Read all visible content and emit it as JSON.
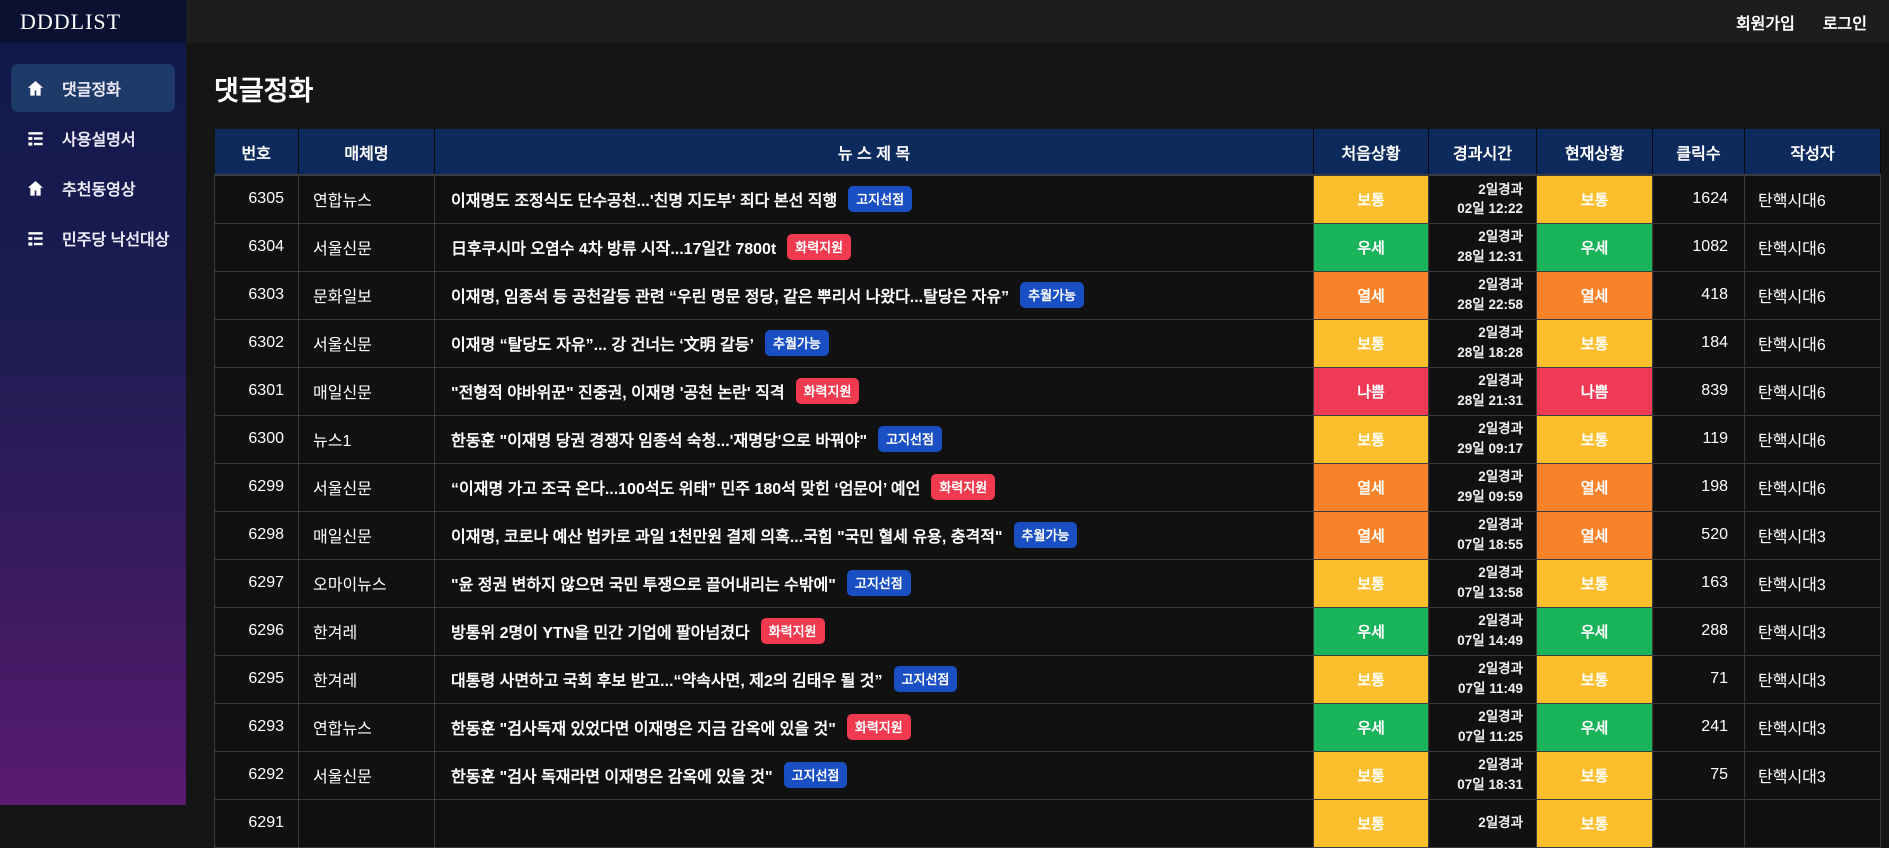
{
  "brand": "DDDLIST",
  "topbar": {
    "signup": "회원가입",
    "login": "로그인"
  },
  "page": {
    "title": "댓글정화"
  },
  "sidebar": {
    "items": [
      {
        "icon": "home",
        "label": "댓글정화",
        "active": true
      },
      {
        "icon": "list",
        "label": "사용설명서",
        "active": false
      },
      {
        "icon": "home",
        "label": "추천동영상",
        "active": false
      },
      {
        "icon": "list",
        "label": "민주당 낙선대상",
        "active": false
      }
    ]
  },
  "colors": {
    "status": {
      "보통": "#fcbe2d",
      "우세": "#1ab45b",
      "열세": "#f8822a",
      "나쁨": "#ee3a55"
    },
    "badge": {
      "고지선점": "#1a4fc4",
      "추월가능": "#1a4fc4",
      "화력지원": "#ef3a4f"
    },
    "header_bg": "#0c2a5c",
    "accent_purple": "#5a1a70"
  },
  "table": {
    "headers": [
      "번호",
      "매체명",
      "뉴 스 제 목",
      "처음상황",
      "경과시간",
      "현재상황",
      "클릭수",
      "작성자"
    ],
    "rows": [
      {
        "no": "6305",
        "media": "연합뉴스",
        "title": "이재명도 조정식도 단수공천...'친명 지도부' 죄다 본선 직행",
        "badge": "고지선점",
        "start": "보통",
        "elapsed1": "2일경과",
        "elapsed2": "02일 12:22",
        "now": "보통",
        "clicks": "1624",
        "author": "탄핵시대6"
      },
      {
        "no": "6304",
        "media": "서울신문",
        "title": "日후쿠시마 오염수 4차 방류 시작...17일간 7800t",
        "badge": "화력지원",
        "start": "우세",
        "elapsed1": "2일경과",
        "elapsed2": "28일 12:31",
        "now": "우세",
        "clicks": "1082",
        "author": "탄핵시대6"
      },
      {
        "no": "6303",
        "media": "문화일보",
        "title": "이재명, 임종석 등 공천갈등 관련 “우린 명문 정당, 같은 뿌리서 나왔다...탈당은 자유”",
        "badge": "추월가능",
        "start": "열세",
        "elapsed1": "2일경과",
        "elapsed2": "28일 22:58",
        "now": "열세",
        "clicks": "418",
        "author": "탄핵시대6"
      },
      {
        "no": "6302",
        "media": "서울신문",
        "title": "이재명 “탈당도 자유”... 강 건너는 ‘文明 갈등’",
        "badge": "추월가능",
        "start": "보통",
        "elapsed1": "2일경과",
        "elapsed2": "28일 18:28",
        "now": "보통",
        "clicks": "184",
        "author": "탄핵시대6"
      },
      {
        "no": "6301",
        "media": "매일신문",
        "title": "\"전형적 야바위꾼\" 진중권, 이재명 '공천 논란' 직격",
        "badge": "화력지원",
        "start": "나쁨",
        "elapsed1": "2일경과",
        "elapsed2": "28일 21:31",
        "now": "나쁨",
        "clicks": "839",
        "author": "탄핵시대6"
      },
      {
        "no": "6300",
        "media": "뉴스1",
        "title": "한동훈 \"이재명 당권 경쟁자 임종석 숙청...'재명당'으로 바꿔야\"",
        "badge": "고지선점",
        "start": "보통",
        "elapsed1": "2일경과",
        "elapsed2": "29일 09:17",
        "now": "보통",
        "clicks": "119",
        "author": "탄핵시대6"
      },
      {
        "no": "6299",
        "media": "서울신문",
        "title": "“이재명 가고 조국 온다...100석도 위태” 민주 180석 맞힌 ‘엄문어’ 예언",
        "badge": "화력지원",
        "start": "열세",
        "elapsed1": "2일경과",
        "elapsed2": "29일 09:59",
        "now": "열세",
        "clicks": "198",
        "author": "탄핵시대6"
      },
      {
        "no": "6298",
        "media": "매일신문",
        "title": "이재명, 코로나 예산 법카로 과일 1천만원 결제 의혹...국힘 \"국민 혈세 유용, 충격적\"",
        "badge": "추월가능",
        "start": "열세",
        "elapsed1": "2일경과",
        "elapsed2": "07일 18:55",
        "now": "열세",
        "clicks": "520",
        "author": "탄핵시대3"
      },
      {
        "no": "6297",
        "media": "오마이뉴스",
        "title": "\"윤 정권 변하지 않으면 국민 투쟁으로 끌어내리는 수밖에\"",
        "badge": "고지선점",
        "start": "보통",
        "elapsed1": "2일경과",
        "elapsed2": "07일 13:58",
        "now": "보통",
        "clicks": "163",
        "author": "탄핵시대3"
      },
      {
        "no": "6296",
        "media": "한겨레",
        "title": "방통위 2명이 YTN을 민간 기업에 팔아넘겼다",
        "badge": "화력지원",
        "start": "우세",
        "elapsed1": "2일경과",
        "elapsed2": "07일 14:49",
        "now": "우세",
        "clicks": "288",
        "author": "탄핵시대3"
      },
      {
        "no": "6295",
        "media": "한겨레",
        "title": "대통령 사면하고 국회 후보 받고...“약속사면, 제2의 김태우 될 것”",
        "badge": "고지선점",
        "start": "보통",
        "elapsed1": "2일경과",
        "elapsed2": "07일 11:49",
        "now": "보통",
        "clicks": "71",
        "author": "탄핵시대3"
      },
      {
        "no": "6293",
        "media": "연합뉴스",
        "title": "한동훈 \"검사독재 있었다면 이재명은 지금 감옥에 있을 것\"",
        "badge": "화력지원",
        "start": "우세",
        "elapsed1": "2일경과",
        "elapsed2": "07일 11:25",
        "now": "우세",
        "clicks": "241",
        "author": "탄핵시대3"
      },
      {
        "no": "6292",
        "media": "서울신문",
        "title": "한동훈 \"검사 독재라면 이재명은 감옥에 있을 것\"",
        "badge": "고지선점",
        "start": "보통",
        "elapsed1": "2일경과",
        "elapsed2": "07일 18:31",
        "now": "보통",
        "clicks": "75",
        "author": "탄핵시대3"
      },
      {
        "no": "6291",
        "media": "",
        "title": "",
        "badge": "",
        "start": "보통",
        "elapsed1": "2일경과",
        "elapsed2": "",
        "now": "보통",
        "clicks": "",
        "author": ""
      }
    ]
  }
}
